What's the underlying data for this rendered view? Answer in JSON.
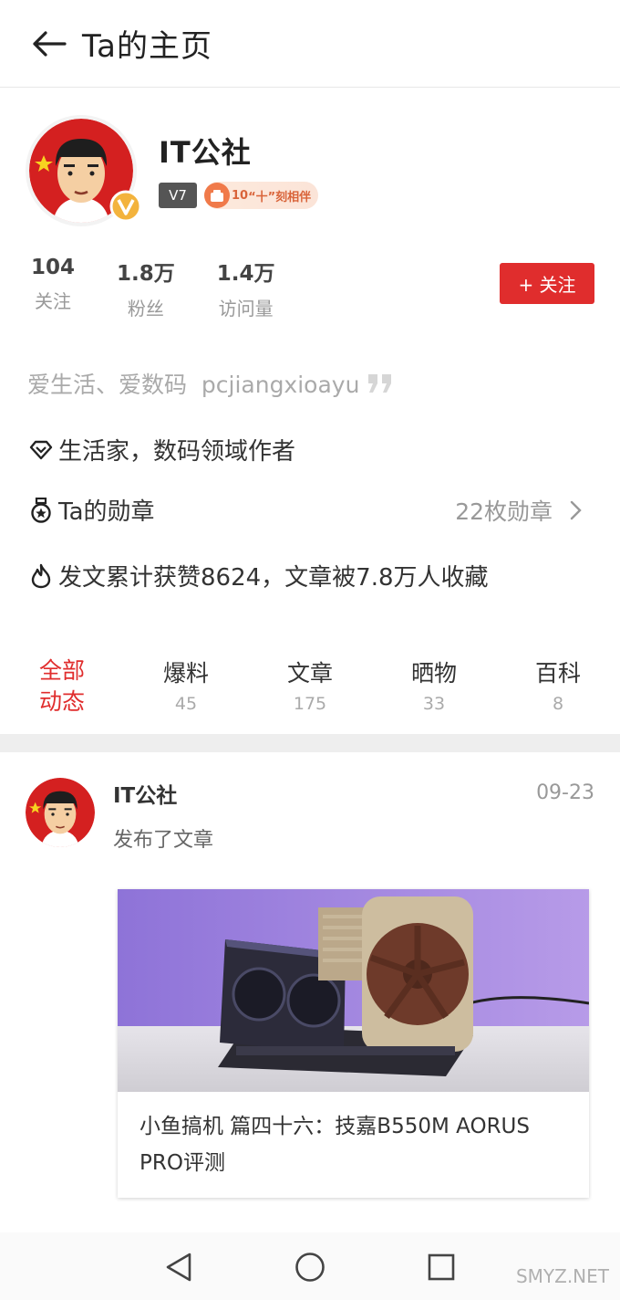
{
  "header": {
    "title": "Ta的主页"
  },
  "profile": {
    "name": "IT公社",
    "level": "V7",
    "medal_text": "“十”刻相伴",
    "medal_prefix": "10"
  },
  "stats": [
    {
      "value": "104",
      "label": "关注"
    },
    {
      "value": "1.8万",
      "label": "粉丝"
    },
    {
      "value": "1.4万",
      "label": "访问量"
    }
  ],
  "follow_button": "+ 关注",
  "bio": "爱生活、爱数码  pcjiangxioayu",
  "info": {
    "role": "生活家，数码领域作者",
    "medals_label": "Ta的勋章",
    "medals_count": "22枚勋章",
    "likes": "发文累计获赞8624，文章被7.8万人收藏"
  },
  "tabs": [
    {
      "label": "全部\n动态",
      "count": "",
      "active": true
    },
    {
      "label": "爆料",
      "count": "45"
    },
    {
      "label": "文章",
      "count": "175"
    },
    {
      "label": "晒物",
      "count": "33"
    },
    {
      "label": "百科",
      "count": "8"
    }
  ],
  "feed": {
    "author": "IT公社",
    "date": "09-23",
    "action": "发布了文章",
    "card_title": "小鱼搞机 篇四十六：技嘉B550M AORUS PRO评测"
  },
  "watermark": "SMYZ.NET",
  "colors": {
    "accent": "#e02d2d",
    "muted": "#999999"
  }
}
